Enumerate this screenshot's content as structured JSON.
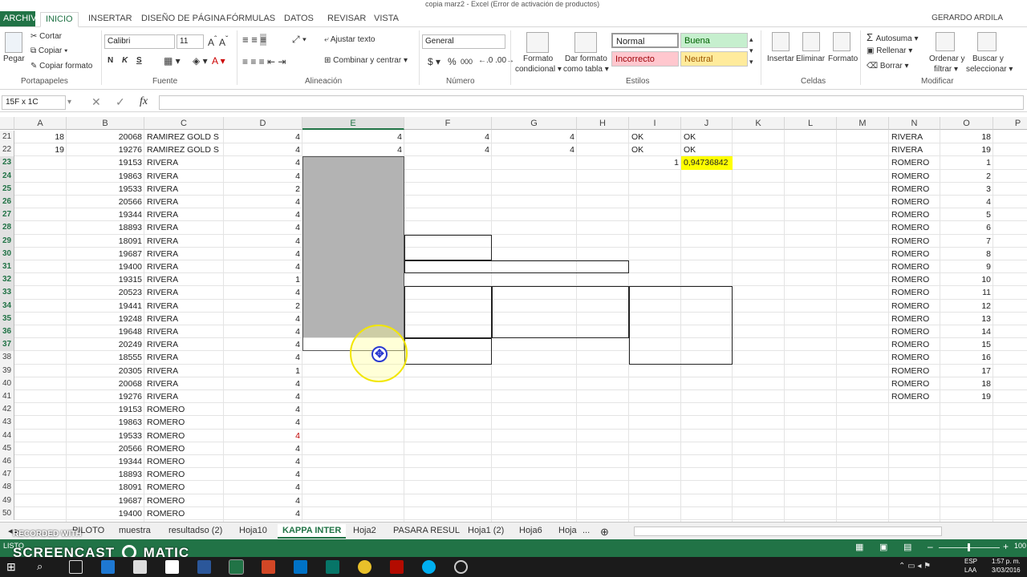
{
  "window": {
    "title": "copia marz2 - Excel (Error de activación de productos)",
    "user": "GERARDO ARDILA"
  },
  "tabs": [
    "ARCHIVO",
    "INICIO",
    "INSERTAR",
    "DISEÑO DE PÁGINA",
    "FÓRMULAS",
    "DATOS",
    "REVISAR",
    "VISTA"
  ],
  "ribbon": {
    "clipboard": {
      "paste": "Pegar",
      "cut": "Cortar",
      "copy": "Copiar",
      "format_painter": "Copiar formato",
      "label": "Portapapeles"
    },
    "font": {
      "name": "Calibri",
      "size": "11",
      "bold": "N",
      "italic": "K",
      "underline": "S",
      "label": "Fuente"
    },
    "alignment": {
      "wrap": "Ajustar texto",
      "merge": "Combinar y centrar",
      "label": "Alineación"
    },
    "number": {
      "format": "General",
      "currency": "$",
      "percent": "%",
      "thousands": "000",
      "label": "Número"
    },
    "styles": {
      "cond_format_1": "Formato",
      "cond_format_2": "condicional",
      "table_format_1": "Dar formato",
      "table_format_2": "como tabla",
      "normal": "Normal",
      "good": "Buena",
      "bad": "Incorrecto",
      "neutral": "Neutral",
      "label": "Estilos"
    },
    "cells": {
      "insert": "Insertar",
      "delete": "Eliminar",
      "format": "Formato",
      "label": "Celdas"
    },
    "editing": {
      "autosum": "Autosuma",
      "fill": "Rellenar",
      "clear": "Borrar",
      "sort_1": "Ordenar y",
      "sort_2": "filtrar",
      "find_1": "Buscar y",
      "find_2": "seleccionar",
      "label": "Modificar"
    }
  },
  "formula_bar": {
    "name_box": "15F x 1C",
    "fx": "fx",
    "content": ""
  },
  "columns": [
    "A",
    "B",
    "C",
    "D",
    "E",
    "F",
    "G",
    "H",
    "I",
    "J",
    "K",
    "L",
    "M",
    "N",
    "O",
    "P"
  ],
  "rows": [
    {
      "n": "21",
      "A": "18",
      "B": "20068",
      "C": "RAMIREZ GOLD S",
      "D": "4",
      "E": "4",
      "F": "4",
      "G": "4",
      "I": "OK",
      "J": "OK",
      "N": "RIVERA",
      "O": "18"
    },
    {
      "n": "22",
      "A": "19",
      "B": "19276",
      "C": "RAMIREZ GOLD S",
      "D": "4",
      "E": "4",
      "F": "4",
      "G": "4",
      "I": "OK",
      "J": "OK",
      "N": "RIVERA",
      "O": "19"
    },
    {
      "n": "23",
      "B": "19153",
      "C": "RIVERA",
      "D": "4",
      "I": "1",
      "J": "0,94736842",
      "N": "ROMERO",
      "O": "1"
    },
    {
      "n": "24",
      "B": "19863",
      "C": "RIVERA",
      "D": "4",
      "N": "ROMERO",
      "O": "2"
    },
    {
      "n": "25",
      "B": "19533",
      "C": "RIVERA",
      "D": "2",
      "N": "ROMERO",
      "O": "3"
    },
    {
      "n": "26",
      "B": "20566",
      "C": "RIVERA",
      "D": "4",
      "N": "ROMERO",
      "O": "4"
    },
    {
      "n": "27",
      "B": "19344",
      "C": "RIVERA",
      "D": "4",
      "N": "ROMERO",
      "O": "5"
    },
    {
      "n": "28",
      "B": "18893",
      "C": "RIVERA",
      "D": "4",
      "N": "ROMERO",
      "O": "6"
    },
    {
      "n": "29",
      "B": "18091",
      "C": "RIVERA",
      "D": "4",
      "N": "ROMERO",
      "O": "7"
    },
    {
      "n": "30",
      "B": "19687",
      "C": "RIVERA",
      "D": "4",
      "N": "ROMERO",
      "O": "8"
    },
    {
      "n": "31",
      "B": "19400",
      "C": "RIVERA",
      "D": "4",
      "N": "ROMERO",
      "O": "9"
    },
    {
      "n": "32",
      "B": "19315",
      "C": "RIVERA",
      "D": "1",
      "N": "ROMERO",
      "O": "10"
    },
    {
      "n": "33",
      "B": "20523",
      "C": "RIVERA",
      "D": "4",
      "N": "ROMERO",
      "O": "11"
    },
    {
      "n": "34",
      "B": "19441",
      "C": "RIVERA",
      "D": "2",
      "N": "ROMERO",
      "O": "12"
    },
    {
      "n": "35",
      "B": "19248",
      "C": "RIVERA",
      "D": "4",
      "N": "ROMERO",
      "O": "13"
    },
    {
      "n": "36",
      "B": "19648",
      "C": "RIVERA",
      "D": "4",
      "N": "ROMERO",
      "O": "14"
    },
    {
      "n": "37",
      "B": "20249",
      "C": "RIVERA",
      "D": "4",
      "N": "ROMERO",
      "O": "15"
    },
    {
      "n": "38",
      "B": "18555",
      "C": "RIVERA",
      "D": "4",
      "N": "ROMERO",
      "O": "16"
    },
    {
      "n": "39",
      "B": "20305",
      "C": "RIVERA",
      "D": "1",
      "N": "ROMERO",
      "O": "17"
    },
    {
      "n": "40",
      "B": "20068",
      "C": "RIVERA",
      "D": "4",
      "N": "ROMERO",
      "O": "18"
    },
    {
      "n": "41",
      "B": "19276",
      "C": "RIVERA",
      "D": "4",
      "N": "ROMERO",
      "O": "19"
    },
    {
      "n": "42",
      "B": "19153",
      "C": "ROMERO",
      "D": "4"
    },
    {
      "n": "43",
      "B": "19863",
      "C": "ROMERO",
      "D": "4"
    },
    {
      "n": "44",
      "B": "19533",
      "C": "ROMERO",
      "D": "4",
      "red": true
    },
    {
      "n": "45",
      "B": "20566",
      "C": "ROMERO",
      "D": "4"
    },
    {
      "n": "46",
      "B": "19344",
      "C": "ROMERO",
      "D": "4"
    },
    {
      "n": "47",
      "B": "18893",
      "C": "ROMERO",
      "D": "4"
    },
    {
      "n": "48",
      "B": "18091",
      "C": "ROMERO",
      "D": "4"
    },
    {
      "n": "49",
      "B": "19687",
      "C": "ROMERO",
      "D": "4"
    },
    {
      "n": "50",
      "B": "19400",
      "C": "ROMERO",
      "D": "4"
    }
  ],
  "selected_rows": [
    "23",
    "24",
    "25",
    "26",
    "27",
    "28",
    "29",
    "30",
    "31",
    "32",
    "33",
    "34",
    "35",
    "36",
    "37"
  ],
  "selected_column": "E",
  "sheets": [
    "PILOTO",
    "muestra",
    "resultadso (2)",
    "Hoja10",
    "KAPPA INTER",
    "Hoja2",
    "PASARA RESUL",
    "Hoja1 (2)",
    "Hoja6",
    "Hoja"
  ],
  "active_sheet": "KAPPA INTER",
  "more_sheets": "...",
  "status": {
    "ready": "LISTO",
    "zoom": "100"
  },
  "taskbar": {
    "lang1": "ESP",
    "lang2": "LAA",
    "time": "1:57 p. m.",
    "date": "3/03/2016"
  },
  "watermark": {
    "top": "RECORDED WITH",
    "main": "SCREENCAST",
    "brand": "MATIC"
  },
  "colors": {
    "excel_green": "#217346",
    "good_bg": "#c6efce",
    "bad_bg": "#ffc7ce",
    "neutral_bg": "#ffeb9c",
    "highlight": "#ffff00"
  }
}
